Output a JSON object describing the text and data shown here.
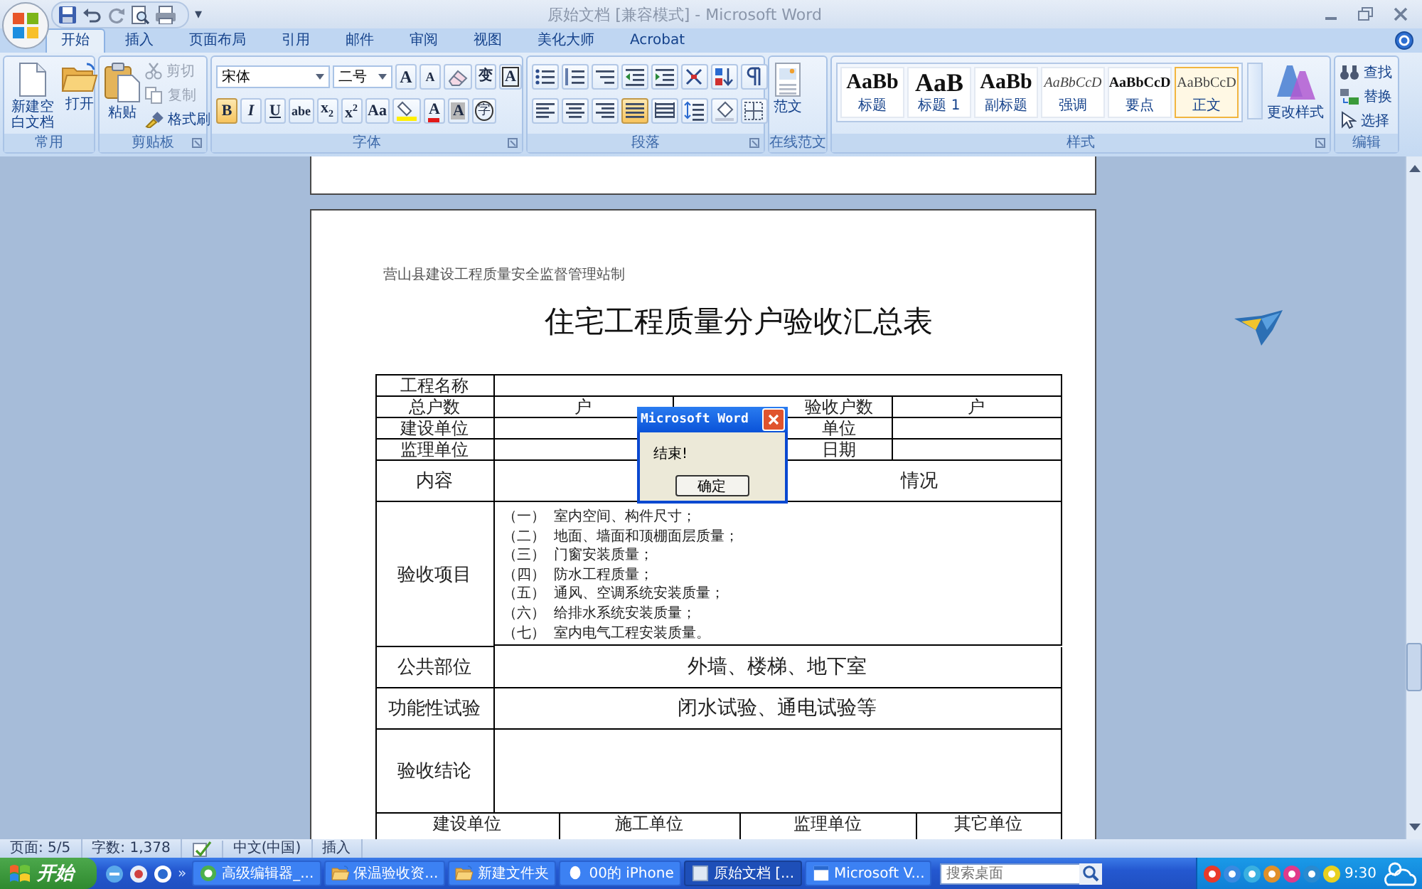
{
  "window": {
    "title": "原始文档 [兼容模式] - Microsoft Word"
  },
  "qat": {
    "more": "▾"
  },
  "tabs": [
    {
      "label": "开始",
      "selected": true
    },
    {
      "label": "插入",
      "selected": false
    },
    {
      "label": "页面布局",
      "selected": false
    },
    {
      "label": "引用",
      "selected": false
    },
    {
      "label": "邮件",
      "selected": false
    },
    {
      "label": "审阅",
      "selected": false
    },
    {
      "label": "视图",
      "selected": false
    },
    {
      "label": "美化大师",
      "selected": false
    },
    {
      "label": "Acrobat",
      "selected": false
    }
  ],
  "ribbon": [
    {
      "title": "常用",
      "kind": "large",
      "items": [
        {
          "label": "新建空白文档"
        },
        {
          "label": "打开"
        }
      ]
    },
    {
      "title": "剪贴板",
      "kind": "clipboard",
      "paste": {
        "label": "粘贴"
      },
      "items": [
        {
          "label": "剪切",
          "disabled": true
        },
        {
          "label": "复制",
          "disabled": true
        },
        {
          "label": "格式刷",
          "disabled": false
        }
      ]
    },
    {
      "title": "字体",
      "kind": "font",
      "fields": [
        {
          "value": "宋体"
        },
        {
          "value": "二号"
        }
      ],
      "upper": [
        {
          "label": "A",
          "selected": false
        },
        {
          "label": "A",
          "selected": false
        },
        {
          "selected": false
        },
        {
          "label": "变",
          "selected": false
        },
        {
          "label": "A",
          "selected": false
        }
      ],
      "lower": [
        {
          "label": "B",
          "selected": true
        },
        {
          "label": "I",
          "selected": false
        },
        {
          "label": "U",
          "selected": false
        },
        {
          "label": "abe",
          "selected": false
        },
        {
          "label": "x$_{2}$",
          "selected": false
        },
        {
          "label": "x$^{2}$",
          "selected": false
        },
        {
          "label": "Aa",
          "selected": false
        },
        {
          "selected": false
        },
        {
          "label": "A",
          "selected": false
        },
        {
          "label": "A",
          "selected": false
        },
        {
          "label": "字",
          "selected": false
        }
      ]
    },
    {
      "title": "段落",
      "kind": "paragraph",
      "rows": [
        [
          {
            "selected": false
          },
          {
            "selected": false
          },
          {
            "selected": false
          },
          {
            "selected": false
          },
          {
            "selected": false
          },
          {
            "selected": false
          },
          {
            "selected": false
          },
          {
            "selected": false
          }
        ],
        [
          {
            "selected": false
          },
          {
            "selected": false
          },
          {
            "selected": false
          },
          {
            "selected": true
          },
          {
            "selected": false
          },
          {
            "selected": false
          },
          {
            "selected": false
          },
          {
            "selected": false
          }
        ]
      ]
    },
    {
      "title": "在线范文",
      "kind": "large",
      "items": [
        {
          "label": "范文"
        }
      ]
    },
    {
      "title": "样式",
      "kind": "styles",
      "gallery": [
        {
          "sample": "AaBb",
          "label": "标题",
          "selected": false
        },
        {
          "sample": "AaB",
          "label": "标题 1",
          "selected": false
        },
        {
          "sample": "AaBb",
          "label": "副标题",
          "selected": false
        },
        {
          "sample": "AaBbCcD",
          "label": "强调",
          "selected": false
        },
        {
          "sample": "AaBbCcD",
          "label": "要点",
          "selected": false
        },
        {
          "sample": "AaBbCcD",
          "label": "正文",
          "selected": true
        }
      ],
      "change": {
        "label": "更改样式"
      }
    },
    {
      "title": "编辑",
      "kind": "edit",
      "items": [
        {
          "label": "查找"
        },
        {
          "label": "替换"
        },
        {
          "label": "选择"
        }
      ]
    }
  ],
  "document": {
    "header": "营山县建设工程质量安全监督管理站制",
    "title": "住宅工程质量分户验收汇总表",
    "table": [
      {
        "kind": "name",
        "label": "工程名称"
      },
      {
        "kind": "quad",
        "label": "总户数",
        "col2": "户",
        "col3": "验收户数",
        "col4": "户"
      },
      {
        "kind": "quad",
        "label": "建设单位",
        "col3": "单位"
      },
      {
        "kind": "quad",
        "label": "监理单位",
        "col3": "日期"
      },
      {
        "kind": "section",
        "label": "内容",
        "value": "情况"
      },
      {
        "kind": "list",
        "label": "验收项目",
        "items": [
          {
            "num": "（一）",
            "text": "室内空间、构件尺寸；"
          },
          {
            "num": "（二）",
            "text": "地面、墙面和顶棚面层质量；"
          },
          {
            "num": "（三）",
            "text": "门窗安装质量；"
          },
          {
            "num": "（四）",
            "text": "防水工程质量；"
          },
          {
            "num": "（五）",
            "text": "通风、空调系统安装质量；"
          },
          {
            "num": "（六）",
            "text": "给排水系统安装质量；"
          },
          {
            "num": "（七）",
            "text": "室内电气工程安装质量。"
          }
        ]
      },
      {
        "kind": "wide",
        "label": "公共部位",
        "value": "外墙、楼梯、地下室"
      },
      {
        "kind": "wide",
        "label": "功能性试验",
        "value": "闭水试验、通电试验等"
      },
      {
        "kind": "conclusion",
        "label": "验收结论"
      },
      {
        "kind": "signers",
        "cells": [
          "建设单位",
          "施工单位",
          "监理单位",
          "其它单位"
        ]
      }
    ]
  },
  "dialog": {
    "title": "Microsoft Word",
    "message": "结束!",
    "button": "确定"
  },
  "status_bar": {
    "items": [
      {
        "kind": "text",
        "text": "页面: 5/5"
      },
      {
        "kind": "text",
        "text": "字数: 1,378"
      },
      {
        "kind": "icon"
      },
      {
        "kind": "text",
        "text": "中文(中国)"
      },
      {
        "kind": "text",
        "text": "插入"
      }
    ]
  },
  "taskbar": {
    "start": "开始",
    "more": "»",
    "tasks": [
      {
        "label": "高级编辑器_...",
        "selected": false
      },
      {
        "label": "保温验收资...",
        "selected": false
      },
      {
        "label": "新建文件夹",
        "selected": false
      },
      {
        "label": "00的 iPhone",
        "selected": false
      },
      {
        "label": "原始文档 [...",
        "selected": true
      },
      {
        "label": "Microsoft V...",
        "selected": false
      }
    ],
    "search": {
      "placeholder": "搜索桌面"
    },
    "clock": "9:30"
  }
}
